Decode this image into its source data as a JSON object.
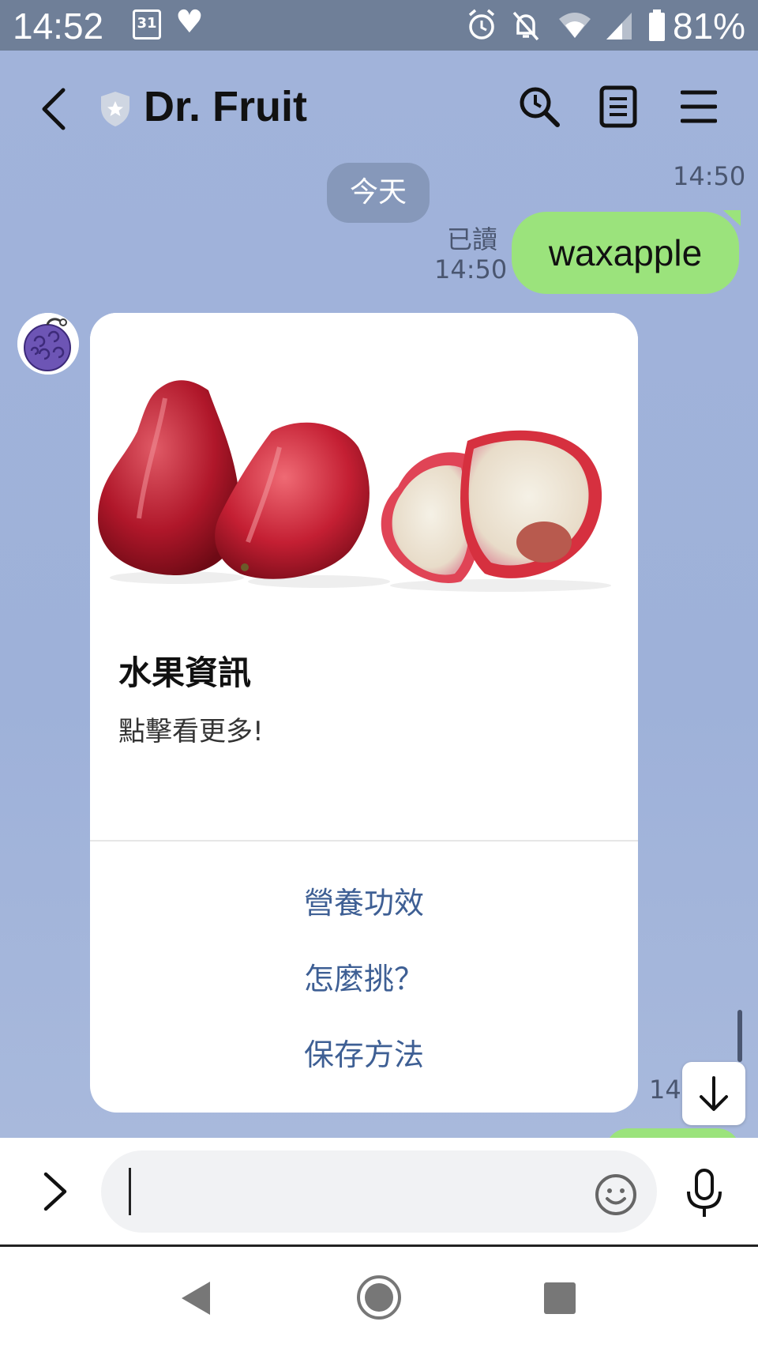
{
  "status_bar": {
    "time": "14:52",
    "calendar_day": "31",
    "battery": "81%",
    "icons": [
      "calendar-icon",
      "heart-icon",
      "alarm-icon",
      "bell-muted-icon",
      "wifi-icon",
      "signal-icon",
      "battery-icon"
    ]
  },
  "header": {
    "title": "Dr. Fruit"
  },
  "chat": {
    "date_chip": "今天",
    "sent_time": "14:50",
    "read_label": "已讀",
    "read_time": "14:50",
    "my_message": "waxapple",
    "bottom_time": "14:"
  },
  "card": {
    "title": "水果資訊",
    "subtitle": "點擊看更多!",
    "actions": [
      "營養功效",
      "怎麼挑？",
      "保存方法"
    ]
  },
  "input": {
    "placeholder": ""
  },
  "colors": {
    "chat_background": "#9fb2d8",
    "my_bubble": "#9be37c",
    "action_text": "#3e5f94",
    "status_bar": "#6f7f98"
  }
}
